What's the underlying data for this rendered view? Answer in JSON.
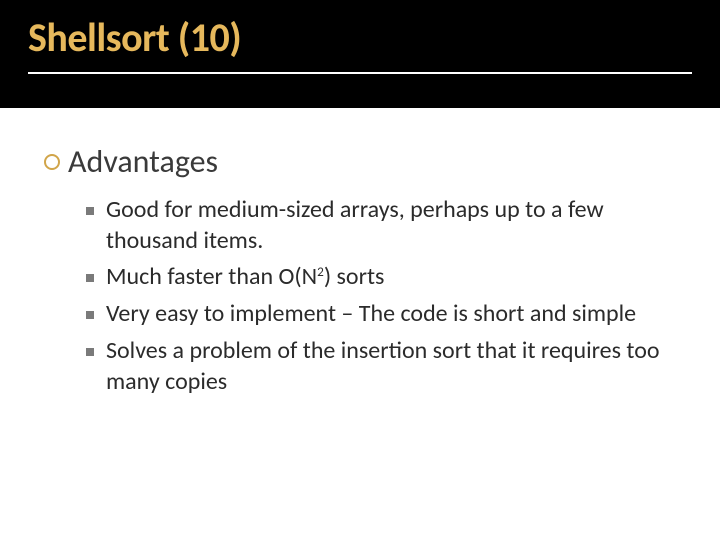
{
  "slide": {
    "title": "Shellsort (10)",
    "heading": "Advantages",
    "points": [
      {
        "text": "Good for medium-sized arrays, perhaps up to a few thousand items."
      },
      {
        "pre": "Much faster than O(N",
        "sup": "2",
        "post": ") sorts"
      },
      {
        "text": "Very easy to implement – The code is short and simple"
      },
      {
        "text": "Solves a problem of the insertion sort that it requires too many copies"
      }
    ]
  }
}
